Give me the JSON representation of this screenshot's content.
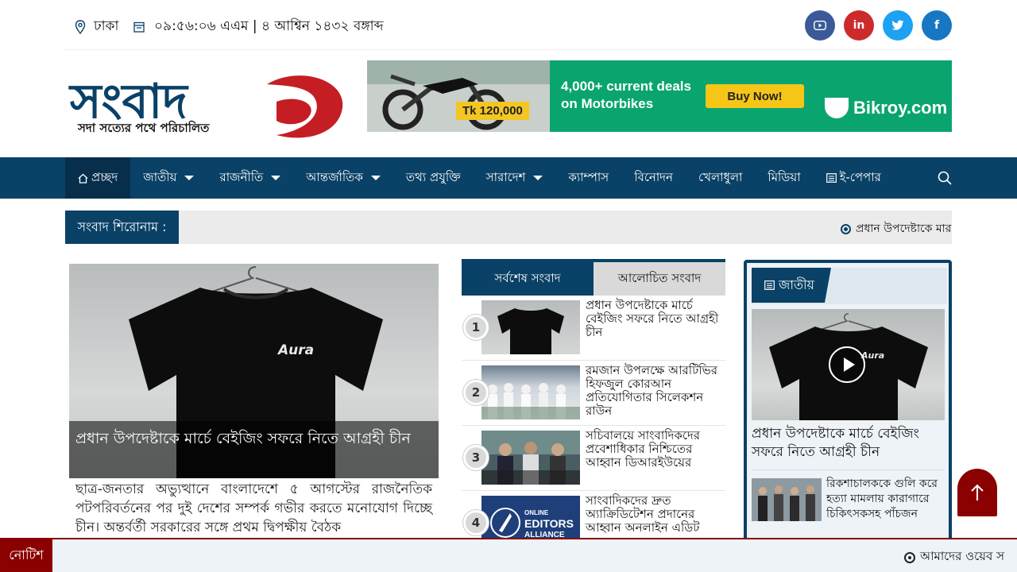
{
  "topbar": {
    "location": "ঢাকা",
    "datetime": "০৯:৫৬:০৬ এএম | ৪ আশ্বিন ১৪৩২ বঙ্গাব্দ",
    "socials": [
      {
        "name": "youtube",
        "color": "#3b5998"
      },
      {
        "name": "linkedin",
        "color": "#cc2b2b",
        "label": "in"
      },
      {
        "name": "twitter",
        "color": "#1da1f2"
      },
      {
        "name": "facebook",
        "color": "#1877c2",
        "label": "f"
      }
    ]
  },
  "header": {
    "logo_main": "সংবাদ",
    "logo_tagline": "সদা সত্যের পথে পরিচালিত",
    "ad": {
      "price": "Tk 120,000",
      "text": "4,000+ current deals on Motorbikes",
      "button": "Buy Now!",
      "brand": "Bikroy.com"
    }
  },
  "nav": {
    "items": [
      {
        "label": "প্রচ্ছদ",
        "dropdown": false,
        "active": true
      },
      {
        "label": "জাতীয়",
        "dropdown": true
      },
      {
        "label": "রাজনীতি",
        "dropdown": true
      },
      {
        "label": "আন্তর্জাতিক",
        "dropdown": true
      },
      {
        "label": "তথ্য প্রযুক্তি",
        "dropdown": false
      },
      {
        "label": "সারাদেশ",
        "dropdown": true
      },
      {
        "label": "ক্যাম্পাস",
        "dropdown": false
      },
      {
        "label": "বিনোদন",
        "dropdown": false
      },
      {
        "label": "খেলাধুলা",
        "dropdown": false
      },
      {
        "label": "মিডিয়া",
        "dropdown": false
      },
      {
        "label": "ই-পেপার",
        "dropdown": false
      }
    ]
  },
  "ticker": {
    "label": "সংবাদ শিরোনাম :",
    "text": "প্রধান উপদেষ্টাকে মার"
  },
  "lead": {
    "title": "প্রধান উপদেষ্টাকে মার্চে বেইজিং সফরে নিতে আগ্রহী চীন",
    "excerpt": "ছাত্র-জনতার অভ্যুত্থানে বাংলাদেশে ৫ আগস্টের রাজনৈতিক পটপরিবর্তনের পর দুই দেশের সম্পর্ক গভীর করতে মনোযোগ দিচ্ছে চীন। অন্তর্বর্তী সরকারের সঙ্গে প্রথম দ্বিপক্ষীয় বৈঠক",
    "shirt_text": "Aura"
  },
  "tabs": {
    "latest": "সর্বশেষ সংবাদ",
    "popular": "আলোচিত সংবাদ"
  },
  "latest": [
    {
      "num": "1",
      "title": "প্রধান উপদেষ্টাকে মার্চে বেইজিং সফরে নিতে আগ্রহী চীন"
    },
    {
      "num": "2",
      "title": "রমজান উপলক্ষে আরটিভির হিফজুল কোরআন প্রতিযোগিতার সিলেকশন রাউন"
    },
    {
      "num": "3",
      "title": "সচিবালয়ে সাংবাদিকদের প্রবেশাধিকার নিশ্চিতের আহ্বান ডিআরইউয়ের"
    },
    {
      "num": "4",
      "title": "সাংবাদিকদের দ্রুত অ্যাক্রিডিটেশন প্রদানের আহ্বান অনলাইন এডিট",
      "thumb_text": "ONLINE EDITORS ALLIANCE"
    }
  ],
  "sidebar": {
    "category": "জাতীয়",
    "main_title": "প্রধান উপদেষ্টাকে মার্চে বেইজিং সফরে নিতে আগ্রহী চীন",
    "sub_title": "রিকশাচালককে গুলি করে হত্যা মামলায় কারাগারে চিকিৎসকসহ পাঁচজন"
  },
  "notice": {
    "label": "নোটিশ",
    "text": "আমাদের ওয়েব স"
  }
}
